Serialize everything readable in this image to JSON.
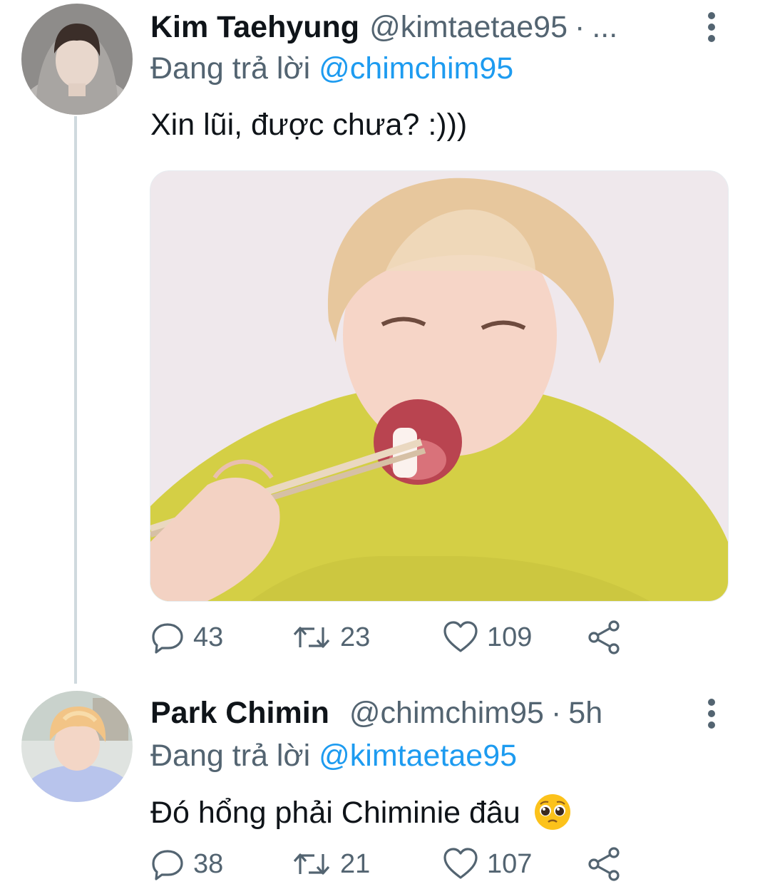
{
  "tweets": [
    {
      "display_name": "Kim Taehyung",
      "handle": "@kimtaetae95",
      "separator": "·",
      "time": "...",
      "reply_prefix": "Đang trả lời",
      "reply_to": "@chimchim95",
      "text": "Xin lũi, được chưa? :)))",
      "has_media": true,
      "stats": {
        "replies": "43",
        "retweets": "23",
        "likes": "109"
      }
    },
    {
      "display_name": "Park Chimin",
      "handle": "@chimchim95",
      "separator": "·",
      "time": "5h",
      "reply_prefix": "Đang trả lời",
      "reply_to": "@kimtaetae95",
      "text": "Đó hổng phải Chiminie đâu",
      "text_emoji": "pleading-face",
      "has_media": false,
      "stats": {
        "replies": "38",
        "retweets": "21",
        "likes": "107"
      }
    }
  ],
  "icons": {
    "reply": "reply-icon",
    "retweet": "retweet-icon",
    "like": "heart-icon",
    "share": "share-icon",
    "more": "more-vertical-icon"
  },
  "colors": {
    "text_primary": "#0f1419",
    "text_secondary": "#536471",
    "link": "#1d9bf0",
    "thread_line": "#cfd9de"
  }
}
